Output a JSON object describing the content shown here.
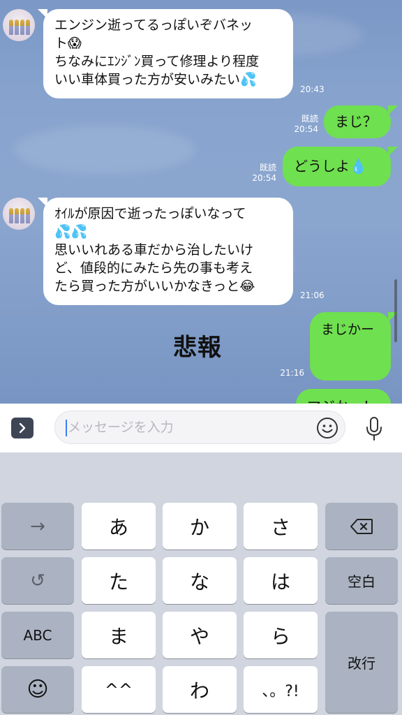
{
  "messages": [
    {
      "side": "in",
      "lines": [
        "エンジン逝ってるっぽいぞバネッ",
        "ト😱",
        "ちなみにｴﾝｼﾞﾝ買って修理より程度",
        "いい車体買った方が安いみたい💦"
      ],
      "time": "20:43"
    },
    {
      "side": "out",
      "lines": [
        "まじ？"
      ],
      "read": "既読",
      "time": "20:54"
    },
    {
      "side": "out",
      "lines": [
        "どうしよ💧"
      ],
      "read": "既読",
      "time": "20:54"
    },
    {
      "side": "in",
      "lines": [
        "ｵｲﾙが原因で逝ったっぽいなって",
        "💦💦",
        "思いいれある車だから治したいけ",
        "ど、値段的にみたら先の事も考え",
        "たら買った方がいいかなきっと😂"
      ],
      "time": "21:06"
    },
    {
      "side": "out",
      "lines": [
        "まじかー"
      ],
      "time": "21:16"
    },
    {
      "side": "out",
      "lines": [
        "マジかー！"
      ]
    }
  ],
  "overlay_text": "悲報",
  "input": {
    "placeholder": "メッセージを入力"
  },
  "icons": {
    "expand": "chevron-right-icon",
    "emoji": "smiley-icon",
    "mic": "microphone-icon"
  },
  "keyboard": {
    "arrow": "→",
    "undo": "↺",
    "abc": "ABC",
    "emoji": "☺",
    "row1": [
      "あ",
      "か",
      "さ"
    ],
    "row2": [
      "た",
      "な",
      "は"
    ],
    "row3": [
      "ま",
      "や",
      "ら"
    ],
    "row4": [
      "^^",
      "わ",
      "、。?!"
    ],
    "space": "空白",
    "enter": "改行"
  },
  "colors": {
    "chat_bg": "#8aa6cf",
    "outgoing_bubble": "#6fe04f",
    "incoming_bubble": "#ffffff",
    "keyboard_bg": "#d0d5df"
  }
}
